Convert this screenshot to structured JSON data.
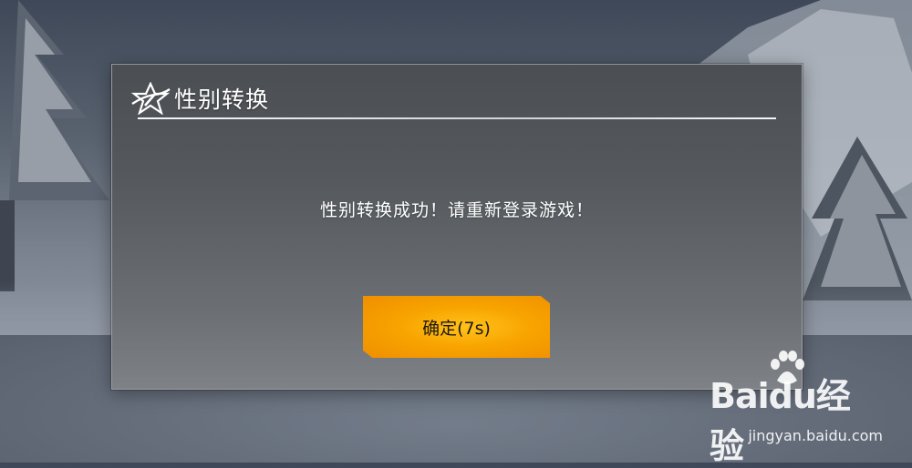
{
  "dialog": {
    "title": "性别转换",
    "message": "性别转换成功！请重新登录游戏！",
    "confirm_label": "确定(7s)",
    "countdown_seconds": 7
  },
  "watermark": {
    "brand": "Baidu经验",
    "url": "jingyan.baidu.com"
  },
  "colors": {
    "button_orange": "#f8a400",
    "dialog_bg": "#55595d",
    "text": "#ffffff"
  },
  "icons": [
    "game-logo-icon",
    "baidu-paw-icon"
  ]
}
